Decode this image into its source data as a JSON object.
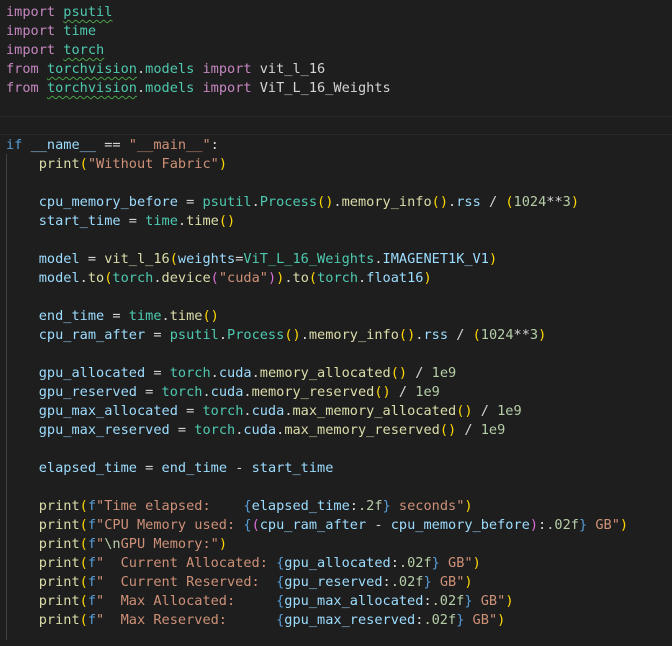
{
  "editor": {
    "language": "python",
    "background": "#1e1e1e",
    "lines": [
      "import psutil",
      "import time",
      "import torch",
      "from torchvision.models import vit_l_16",
      "from torchvision.models import ViT_L_16_Weights",
      "",
      "",
      "if __name__ == \"__main__\":",
      "    print(\"Without Fabric\")",
      "",
      "    cpu_memory_before = psutil.Process().memory_info().rss / (1024**3)",
      "    start_time = time.time()",
      "",
      "    model = vit_l_16(weights=ViT_L_16_Weights.IMAGENET1K_V1)",
      "    model.to(torch.device(\"cuda\")).to(torch.float16)",
      "",
      "    end_time = time.time()",
      "    cpu_ram_after = psutil.Process().memory_info().rss / (1024**3)",
      "",
      "    gpu_allocated = torch.cuda.memory_allocated() / 1e9",
      "    gpu_reserved = torch.cuda.memory_reserved() / 1e9",
      "    gpu_max_allocated = torch.cuda.max_memory_allocated() / 1e9",
      "    gpu_max_reserved = torch.cuda.max_memory_reserved() / 1e9",
      "",
      "    elapsed_time = end_time - start_time",
      "",
      "    print(f\"Time elapsed:    {elapsed_time:.2f} seconds\")",
      "    print(f\"CPU Memory used: {(cpu_ram_after - cpu_memory_before):.02f} GB\")",
      "    print(f\"\\nGPU Memory:\")",
      "    print(f\"  Current Allocated: {gpu_allocated:.02f} GB\")",
      "    print(f\"  Current Reserved:  {gpu_reserved:.02f} GB\")",
      "    print(f\"  Max Allocated:     {gpu_max_allocated:.02f} GB\")",
      "    print(f\"  Max Reserved:      {gpu_max_reserved:.02f} GB\")"
    ]
  }
}
